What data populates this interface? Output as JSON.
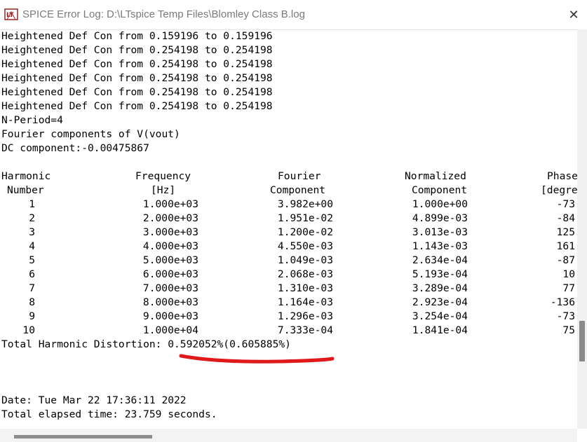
{
  "window": {
    "title": "SPICE Error Log: D:\\LTspice Temp Files\\Blomley Class B.log",
    "close_glyph": "✕",
    "icon": "ltspice-logo-icon"
  },
  "log": {
    "heightened": [
      "Heightened Def Con from 0.159196 to 0.159196",
      "Heightened Def Con from 0.254198 to 0.254198",
      "Heightened Def Con from 0.254198 to 0.254198",
      "Heightened Def Con from 0.254198 to 0.254198",
      "Heightened Def Con from 0.254198 to 0.254198",
      "Heightened Def Con from 0.254198 to 0.254198"
    ],
    "n_period": "N-Period=4",
    "fourier_title": "Fourier components of V(vout)",
    "dc_component": "DC component:-0.00475867",
    "table": {
      "headers": [
        [
          "Harmonic",
          "Frequency",
          "Fourier",
          "Normalized",
          "Phase"
        ],
        [
          "Number",
          "[Hz]",
          "Component",
          "Component",
          "[degre"
        ]
      ],
      "rows": [
        [
          "1",
          "1.000e+03",
          "3.982e+00",
          "1.000e+00",
          "-73"
        ],
        [
          "2",
          "2.000e+03",
          "1.951e-02",
          "4.899e-03",
          "-84"
        ],
        [
          "3",
          "3.000e+03",
          "1.200e-02",
          "3.013e-03",
          "125"
        ],
        [
          "4",
          "4.000e+03",
          "4.550e-03",
          "1.143e-03",
          "161"
        ],
        [
          "5",
          "5.000e+03",
          "1.049e-03",
          "2.634e-04",
          "-87"
        ],
        [
          "6",
          "6.000e+03",
          "2.068e-03",
          "5.193e-04",
          "10"
        ],
        [
          "7",
          "7.000e+03",
          "1.310e-03",
          "3.289e-04",
          "77"
        ],
        [
          "8",
          "8.000e+03",
          "1.164e-03",
          "2.923e-04",
          "-136"
        ],
        [
          "9",
          "9.000e+03",
          "1.296e-03",
          "3.254e-04",
          "-73"
        ],
        [
          "10",
          "1.000e+04",
          "7.333e-04",
          "1.841e-04",
          "75"
        ]
      ]
    },
    "thd": "Total Harmonic Distortion: 0.592052%(0.605885%)",
    "date": "Date: Tue Mar 22 17:36:11 2022",
    "elapsed": "Total elapsed time: 23.759 seconds."
  },
  "colors": {
    "annotation_underline": "#e0191b",
    "title_text": "#7a7a7a"
  }
}
